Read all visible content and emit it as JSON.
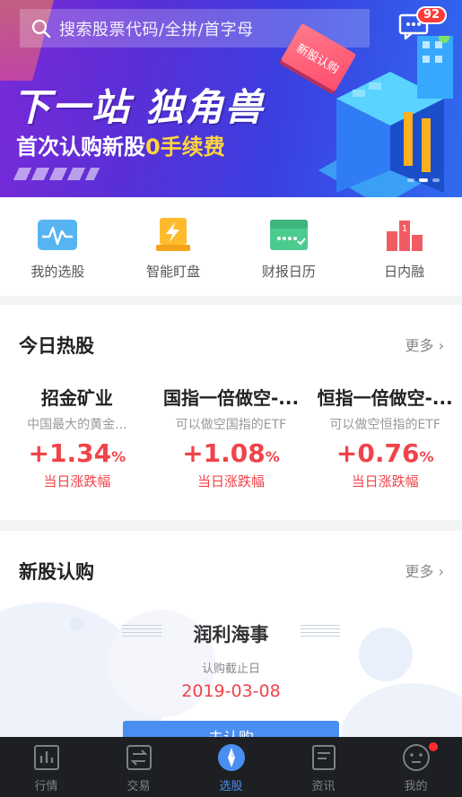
{
  "search": {
    "placeholder": "搜索股票代码/全拼/首字母"
  },
  "messages": {
    "badge": "92"
  },
  "banner": {
    "title": "下一站 独角兽",
    "subtitle_prefix": "首次认购新股",
    "subtitle_highlight": "0手续费",
    "tag": "新股认购",
    "slide_count": 3,
    "active_slide": 2
  },
  "quick_nav": [
    {
      "label": "我的选股",
      "icon": "pulse-chart-icon",
      "color": "#56b4f2"
    },
    {
      "label": "智能盯盘",
      "icon": "lightning-icon",
      "color": "#ffbb2c"
    },
    {
      "label": "财报日历",
      "icon": "calendar-icon",
      "color": "#4ccb8f"
    },
    {
      "label": "日内融",
      "icon": "podium-icon",
      "color": "#f15b63"
    }
  ],
  "hot_stocks": {
    "title": "今日热股",
    "more": "更多",
    "items": [
      {
        "name": "招金矿业",
        "desc": "中国最大的黄金...",
        "change": "+1.34",
        "unit": "%",
        "label": "当日涨跌幅"
      },
      {
        "name": "国指一倍做空-...",
        "desc": "可以做空国指的ETF",
        "change": "+1.08",
        "unit": "%",
        "label": "当日涨跌幅"
      },
      {
        "name": "恒指一倍做空-...",
        "desc": "可以做空恒指的ETF",
        "change": "+0.76",
        "unit": "%",
        "label": "当日涨跌幅"
      }
    ]
  },
  "ipo": {
    "title": "新股认购",
    "more": "更多",
    "stock_name": "润利海事",
    "deadline_label": "认购截止日",
    "deadline": "2019-03-08",
    "button": "去认购"
  },
  "tabbar": [
    {
      "label": "行情",
      "icon": "chart-icon",
      "active": false
    },
    {
      "label": "交易",
      "icon": "exchange-icon",
      "active": false
    },
    {
      "label": "选股",
      "icon": "compass-icon",
      "active": true
    },
    {
      "label": "资讯",
      "icon": "news-icon",
      "active": false
    },
    {
      "label": "我的",
      "icon": "profile-icon",
      "active": false,
      "has_dot": true
    }
  ],
  "colors": {
    "accent": "#4a8ef2",
    "rise": "#f0434a"
  }
}
